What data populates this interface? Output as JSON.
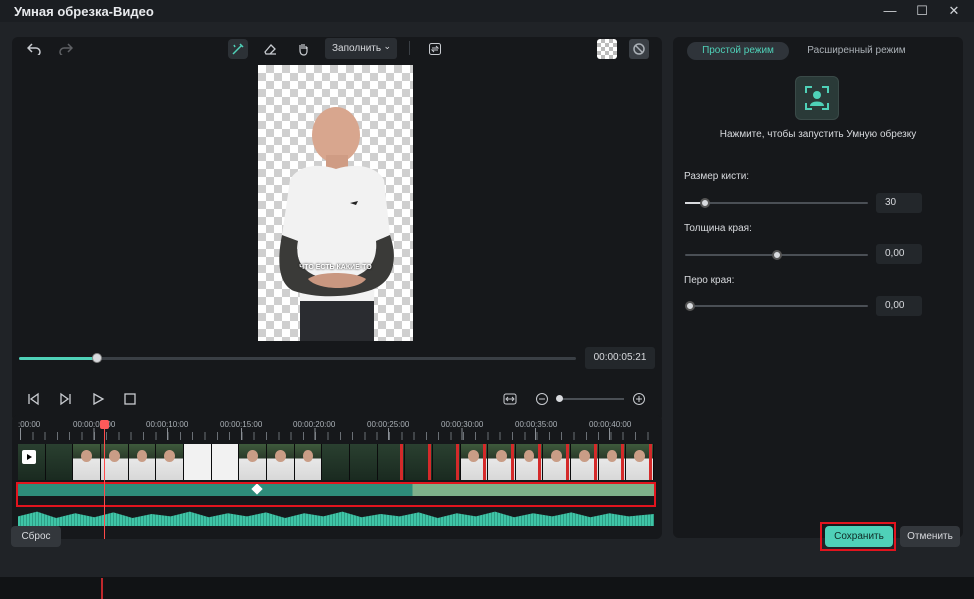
{
  "window": {
    "title": "Умная обрезка-Видео",
    "controls": [
      "minimize-icon",
      "maximize-icon",
      "close-icon"
    ]
  },
  "toolbar": {
    "undo_icon": "undo-icon",
    "redo_icon": "redo-icon",
    "brush_icon": "brush-icon",
    "eraser_icon": "eraser-icon",
    "hand_icon": "hand-icon",
    "fill_select": "Заполнить",
    "swap_icon": "swap-icon",
    "transparent_bg_icon": "checkerboard-icon",
    "no_bg_icon": "disabled-icon"
  },
  "preview": {
    "caption": "ЧТО ЕСТЬ КАКИЕ-ТО"
  },
  "playback": {
    "progress": 0.14,
    "timecode": "00:00:05:21",
    "zoom_level": 0.05
  },
  "timeline": {
    "ruler": [
      ":00:00",
      "00:00:05:00",
      "00:00:10:00",
      "00:00:15:00",
      "00:00:20:00",
      "00:00:25:00",
      "00:00:30:00",
      "00:00:35:00",
      "00:00:40:00"
    ]
  },
  "right_panel": {
    "tabs": [
      {
        "label": "Простой режим",
        "active": true
      },
      {
        "label": "Расширенный режим",
        "active": false
      }
    ],
    "smart_cutout_hint": "Нажмите, чтобы запустить Умную обрезку",
    "sliders": [
      {
        "label": "Размер кисти:",
        "value": "30",
        "fraction": 0.11
      },
      {
        "label": "Толщина края:",
        "value": "0,00",
        "fraction": 0.5
      },
      {
        "label": "Перо края:",
        "value": "0,00",
        "fraction": 0.0
      }
    ]
  },
  "footer": {
    "reset": "Сброс",
    "save": "Сохранить",
    "cancel": "Отменить"
  },
  "colors": {
    "accent": "#4fd1b8",
    "highlight": "#e2141e"
  }
}
